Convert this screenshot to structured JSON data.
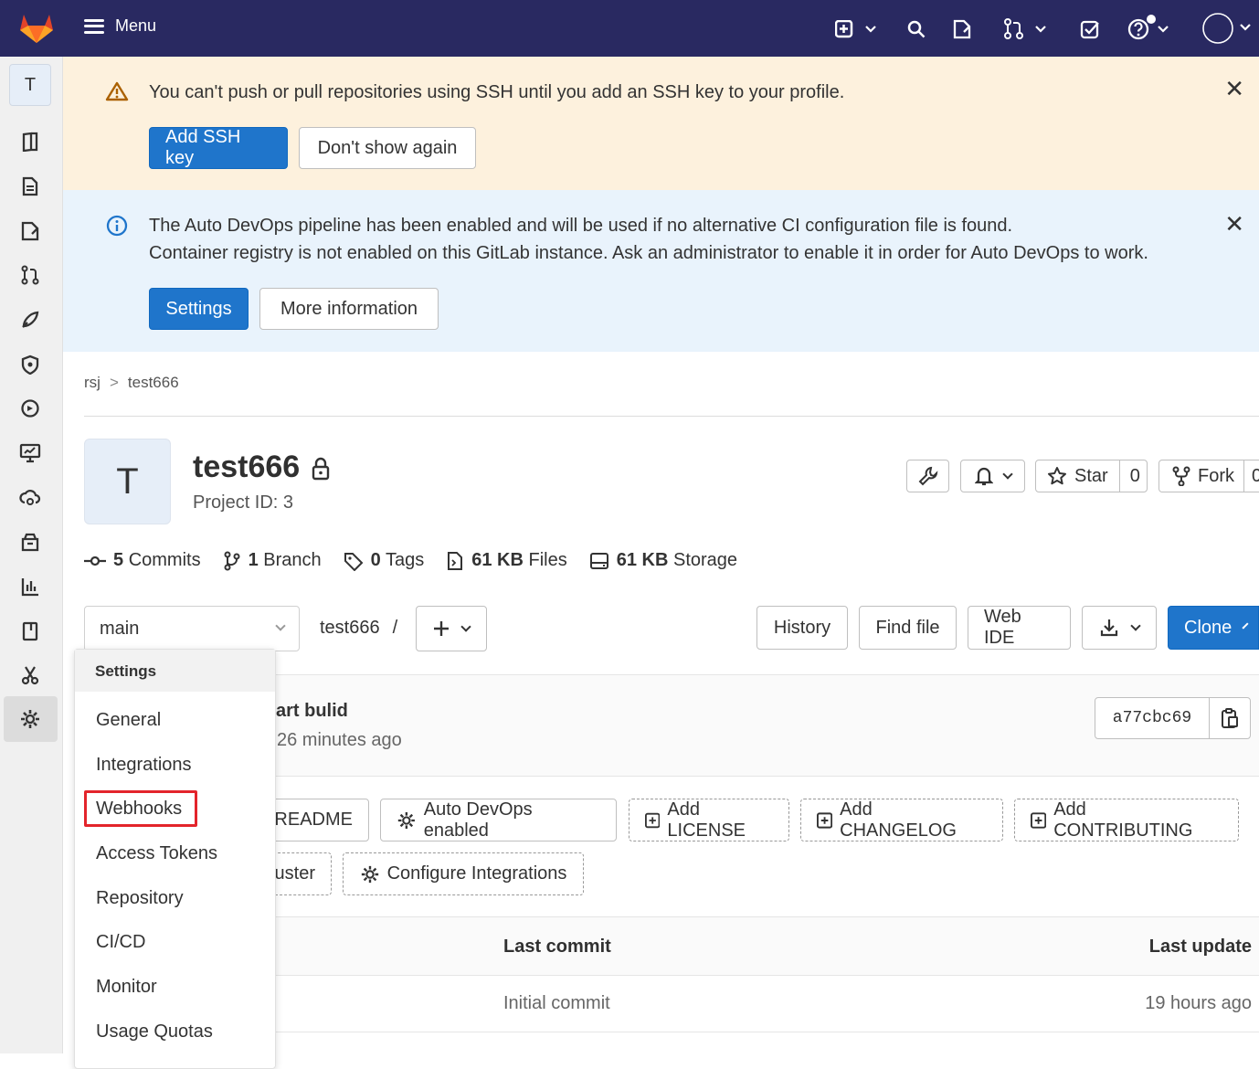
{
  "topbar": {
    "menu_label": "Menu"
  },
  "sidebar": {
    "avatar_letter": "T"
  },
  "ssh_alert": {
    "message": "You can't push or pull repositories using SSH until you add an SSH key to your profile.",
    "add_button": "Add SSH key",
    "dismiss_button": "Don't show again"
  },
  "devops_alert": {
    "line1": "The Auto DevOps pipeline has been enabled and will be used if no alternative CI configuration file is found.",
    "line2": "Container registry is not enabled on this GitLab instance. Ask an administrator to enable it in order for Auto DevOps to work.",
    "settings_button": "Settings",
    "more_button": "More information"
  },
  "breadcrumb": {
    "parent": "rsj",
    "separator": ">",
    "current": "test666"
  },
  "project": {
    "avatar_letter": "T",
    "name": "test666",
    "id_label": "Project ID: 3",
    "star_label": "Star",
    "star_count": "0",
    "fork_label": "Fork",
    "fork_count": "0"
  },
  "stats": {
    "commits_count": "5",
    "commits_label": "Commits",
    "branch_count": "1",
    "branch_label": "Branch",
    "tags_count": "0",
    "tags_label": "Tags",
    "files_size": "61 KB",
    "files_label": "Files",
    "storage_size": "61 KB",
    "storage_label": "Storage"
  },
  "repo_toolbar": {
    "branch": "main",
    "path": "test666",
    "path_sep": "/",
    "history": "History",
    "find_file": "Find file",
    "web_ide": "Web IDE",
    "clone": "Clone"
  },
  "last_commit": {
    "title_partial": "art bulid",
    "time_partial": "26 minutes ago",
    "sha": "a77cbc69"
  },
  "quick_actions": {
    "readme": "README",
    "auto_devops": "Auto DevOps enabled",
    "add_license": "Add LICENSE",
    "add_changelog": "Add CHANGELOG",
    "add_contributing": "Add CONTRIBUTING",
    "cluster_partial": "uster",
    "configure_integrations": "Configure Integrations"
  },
  "file_table": {
    "col_last_commit": "Last commit",
    "col_last_update": "Last update",
    "rows": [
      {
        "last_commit": "Initial commit",
        "last_update": "19 hours ago"
      }
    ]
  },
  "settings_menu": {
    "header": "Settings",
    "items": [
      "General",
      "Integrations",
      "Webhooks",
      "Access Tokens",
      "Repository",
      "CI/CD",
      "Monitor",
      "Usage Quotas"
    ]
  },
  "colors": {
    "topbar": "#292961",
    "primary": "#1f75cb",
    "warn_bg": "#fdf1dd",
    "info_bg": "#e9f3fc",
    "highlight": "#e3242b"
  }
}
